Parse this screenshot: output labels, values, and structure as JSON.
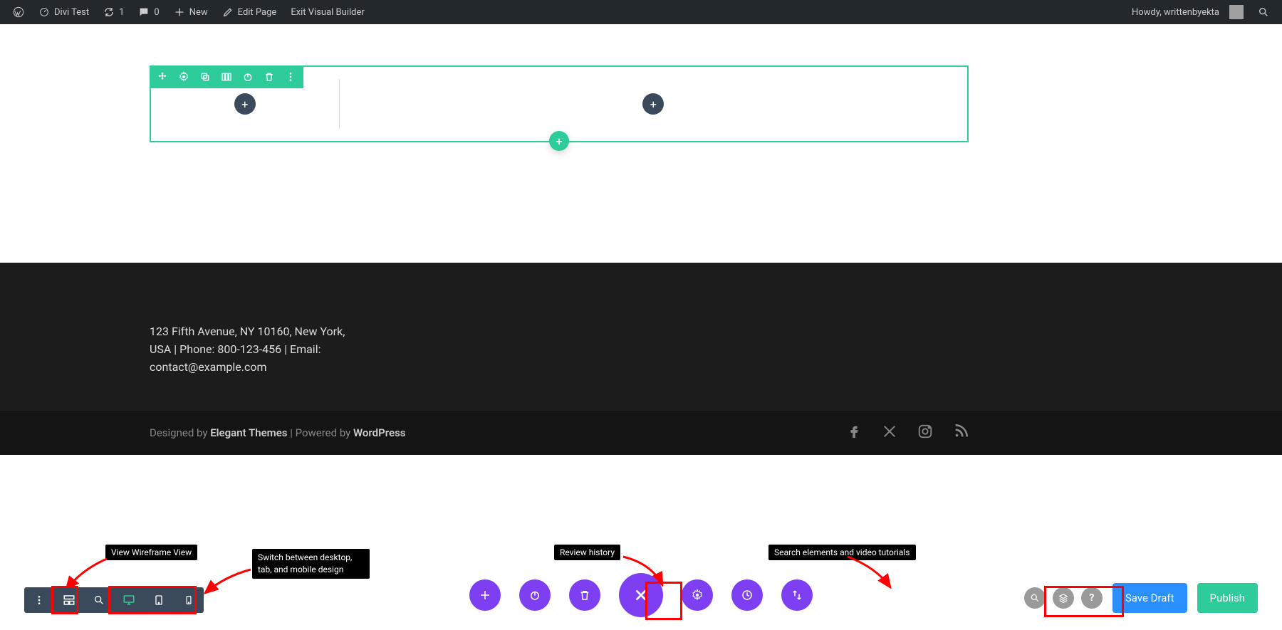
{
  "adminbar": {
    "site_title": "Divi Test",
    "revisions_count": "1",
    "comments_count": "0",
    "new_label": "New",
    "edit_page": "Edit Page",
    "exit_builder": "Exit Visual Builder",
    "howdy": "Howdy, writtenbyekta"
  },
  "footer": {
    "contact_text": "123 Fifth Avenue, NY 10160, New York, USA | Phone: 800-123-456 | Email: contact@example.com",
    "designed_prefix": "Designed by ",
    "designed_brand": "Elegant Themes",
    "powered_sep": " | Powered by ",
    "powered_brand": "WordPress"
  },
  "annotations": {
    "wireframe": "View Wireframe View",
    "device": "Switch between desktop, tab, and mobile design",
    "history": "Review history",
    "search": "Search elements and video tutorials"
  },
  "buttons": {
    "save_draft": "Save Draft",
    "publish": "Publish"
  },
  "icons": {
    "plus": "+",
    "question": "?"
  }
}
